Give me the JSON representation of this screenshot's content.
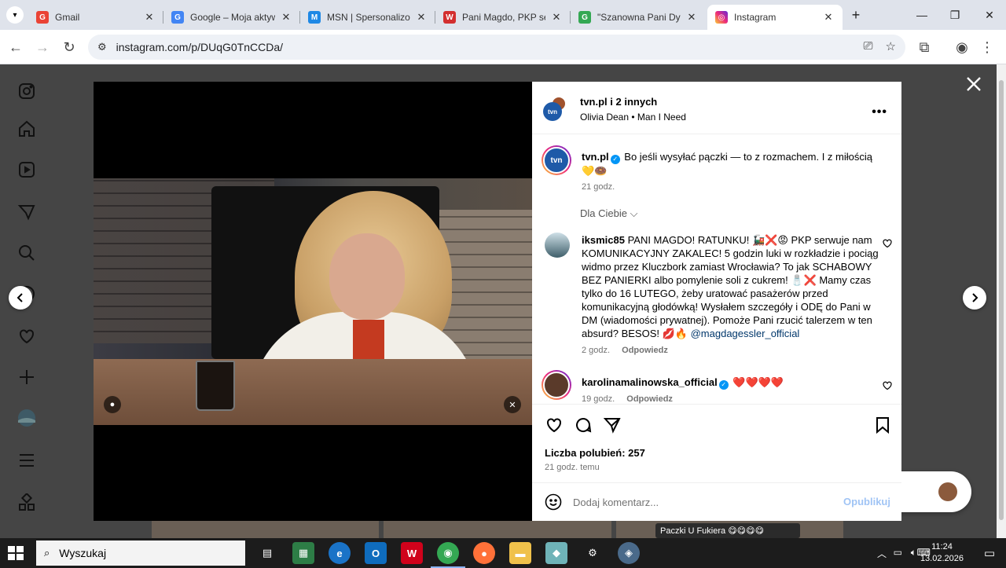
{
  "browser": {
    "tabs": [
      {
        "title": "Gmail",
        "favicon": "G",
        "color": "#ea4335",
        "close": "✕"
      },
      {
        "title": "Google – Moja aktyw",
        "favicon": "G",
        "color": "#4285f4",
        "close": "✕"
      },
      {
        "title": "MSN | Spersonalizow",
        "favicon": "M",
        "color": "#1e88e5",
        "close": "✕"
      },
      {
        "title": "Pani Magdo, PKP ser",
        "favicon": "W",
        "color": "#d32f2f",
        "close": "✕"
      },
      {
        "title": "\"Szanowna Pani Dyre",
        "favicon": "G",
        "color": "#34a853",
        "close": "✕"
      },
      {
        "title": "Instagram",
        "favicon": "I",
        "color": "#d62976",
        "close": "✕"
      }
    ],
    "new_tab": "+",
    "url": "instagram.com/p/DUqG0TnCCDa/"
  },
  "post": {
    "header_user": "tvn.pl i 2 innych",
    "music": "Olivia Dean • Man I Need",
    "more": "•••",
    "caption_user": "tvn.pl",
    "caption_text": "Bo jeśli wysyłać pączki — to z rozmachem. I z miłością 💛🍩",
    "caption_time": "21 godz.",
    "for_you": "Dla Ciebie ⌵",
    "comments": [
      {
        "user": "iksmic85",
        "text": "PANI MAGDO! RATUNKU! 🚂❌😡 PKP serwuje nam KOMUNIKACYJNY ZAKALEC! 5 godzin luki w rozkładzie i pociąg widmo przez Kluczbork zamiast Wrocławia? To jak SCHABOWY BEZ PANIERKI albo pomylenie soli z cukrem! 🧂❌ Mamy czas tylko do 16 LUTEGO, żeby uratować pasażerów przed komunikacyjną głodówką! Wysłałem szczegóły i ODĘ do Pani w DM (wiadomości prywatnej). Pomoże Pani rzucić talerzem w ten absurd? BESOS! 💋🔥",
        "mention": "@magdagessler_official",
        "time": "2 godz.",
        "reply": "Odpowiedz"
      },
      {
        "user": "karolinamalinowska_official",
        "text": "❤️❤️❤️❤️",
        "time": "19 godz.",
        "reply": "Odpowiedz"
      }
    ],
    "likes": "Liczba polubień: 257",
    "time_ago": "21 godz. temu",
    "comment_placeholder": "Dodaj komentarz...",
    "publish": "Opublikuj"
  },
  "background": {
    "strip_tag": "Paczki U Fukiera 😋😋😋😋"
  },
  "taskbar": {
    "search_placeholder": "Wyszukaj",
    "time": "11:24",
    "date": "13.02.2026"
  },
  "colors": {
    "ig_blue": "#0095f6",
    "tvn_blue": "#1e5aa8",
    "overlay": "#454545"
  }
}
